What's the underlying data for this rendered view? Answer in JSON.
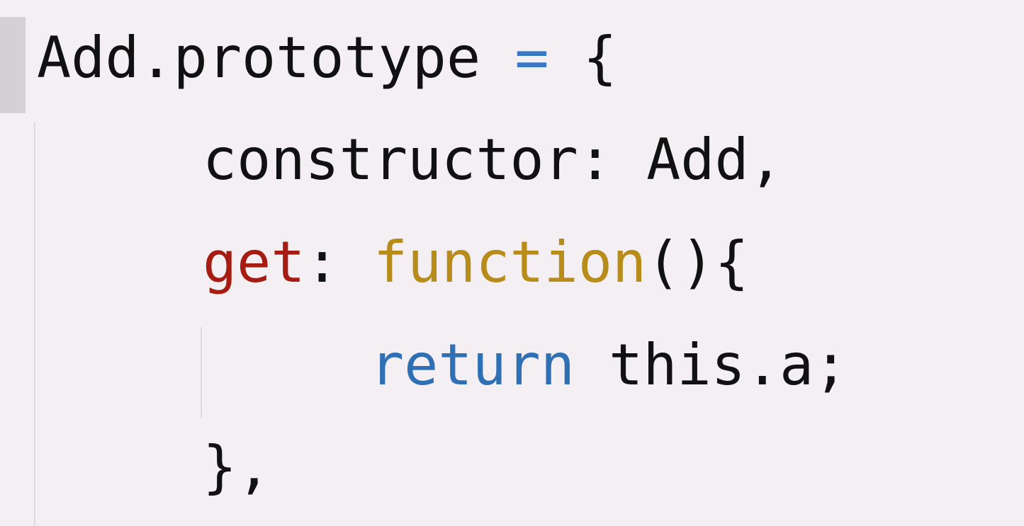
{
  "editor": {
    "line1": {
      "object": "Add.prototype",
      "space1": " ",
      "operator": "=",
      "space2": " ",
      "brace": "{"
    },
    "line2": {
      "text": "constructor: Add,"
    },
    "line3": {
      "prop": "get",
      "colon": ": ",
      "keyword": "function",
      "rest": "(){"
    },
    "line4": {
      "keyword": "return",
      "rest": " this.a;"
    },
    "line5": {
      "text": "},"
    },
    "colors": {
      "background": "#f3eff3",
      "text": "#111111",
      "keyword_blue": "#2f6fb4",
      "property_red": "#a51c12",
      "function_gold": "#b88c1a"
    }
  }
}
